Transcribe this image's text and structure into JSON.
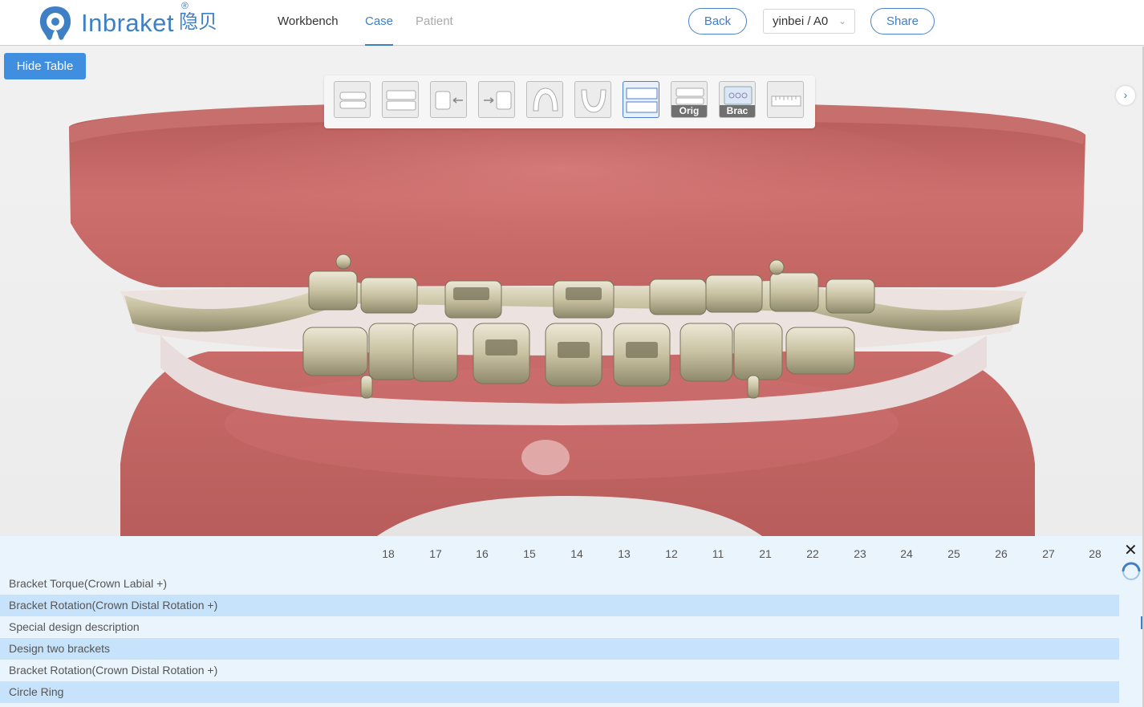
{
  "header": {
    "logo_text": "Inbraket",
    "logo_cn": "隐贝",
    "logo_reg": "®",
    "nav": {
      "workbench": "Workbench",
      "case": "Case",
      "patient": "Patient"
    },
    "back": "Back",
    "select_value": "yinbei / A0",
    "share": "Share"
  },
  "controls": {
    "hide_table": "Hide Table",
    "tools": [
      {
        "icon": "occlusion-front-icon"
      },
      {
        "icon": "occlusion-full-icon"
      },
      {
        "icon": "right-side-view-icon"
      },
      {
        "icon": "left-side-view-icon"
      },
      {
        "icon": "upper-arch-icon"
      },
      {
        "icon": "lower-arch-icon"
      },
      {
        "icon": "split-view-icon",
        "active": true
      },
      {
        "icon": "original-model-icon",
        "label": "Orig"
      },
      {
        "icon": "bracket-icon",
        "label": "Brac"
      },
      {
        "icon": "ruler-icon"
      }
    ]
  },
  "table": {
    "columns": [
      "18",
      "17",
      "16",
      "15",
      "14",
      "13",
      "12",
      "11",
      "21",
      "22",
      "23",
      "24",
      "25",
      "26",
      "27",
      "28"
    ],
    "rows": [
      "Bracket Torque(Crown Labial +)",
      "Bracket Rotation(Crown Distal Rotation +)",
      "Special design description",
      "Design two brackets",
      "Bracket Rotation(Crown Distal Rotation +)",
      "Circle Ring"
    ]
  },
  "colors": {
    "accent": "#3f7fc4",
    "button": "#3f8ee0",
    "gum": "#c96a68",
    "row_alt": "#c7e3fb",
    "panel": "#eaf4fd"
  }
}
